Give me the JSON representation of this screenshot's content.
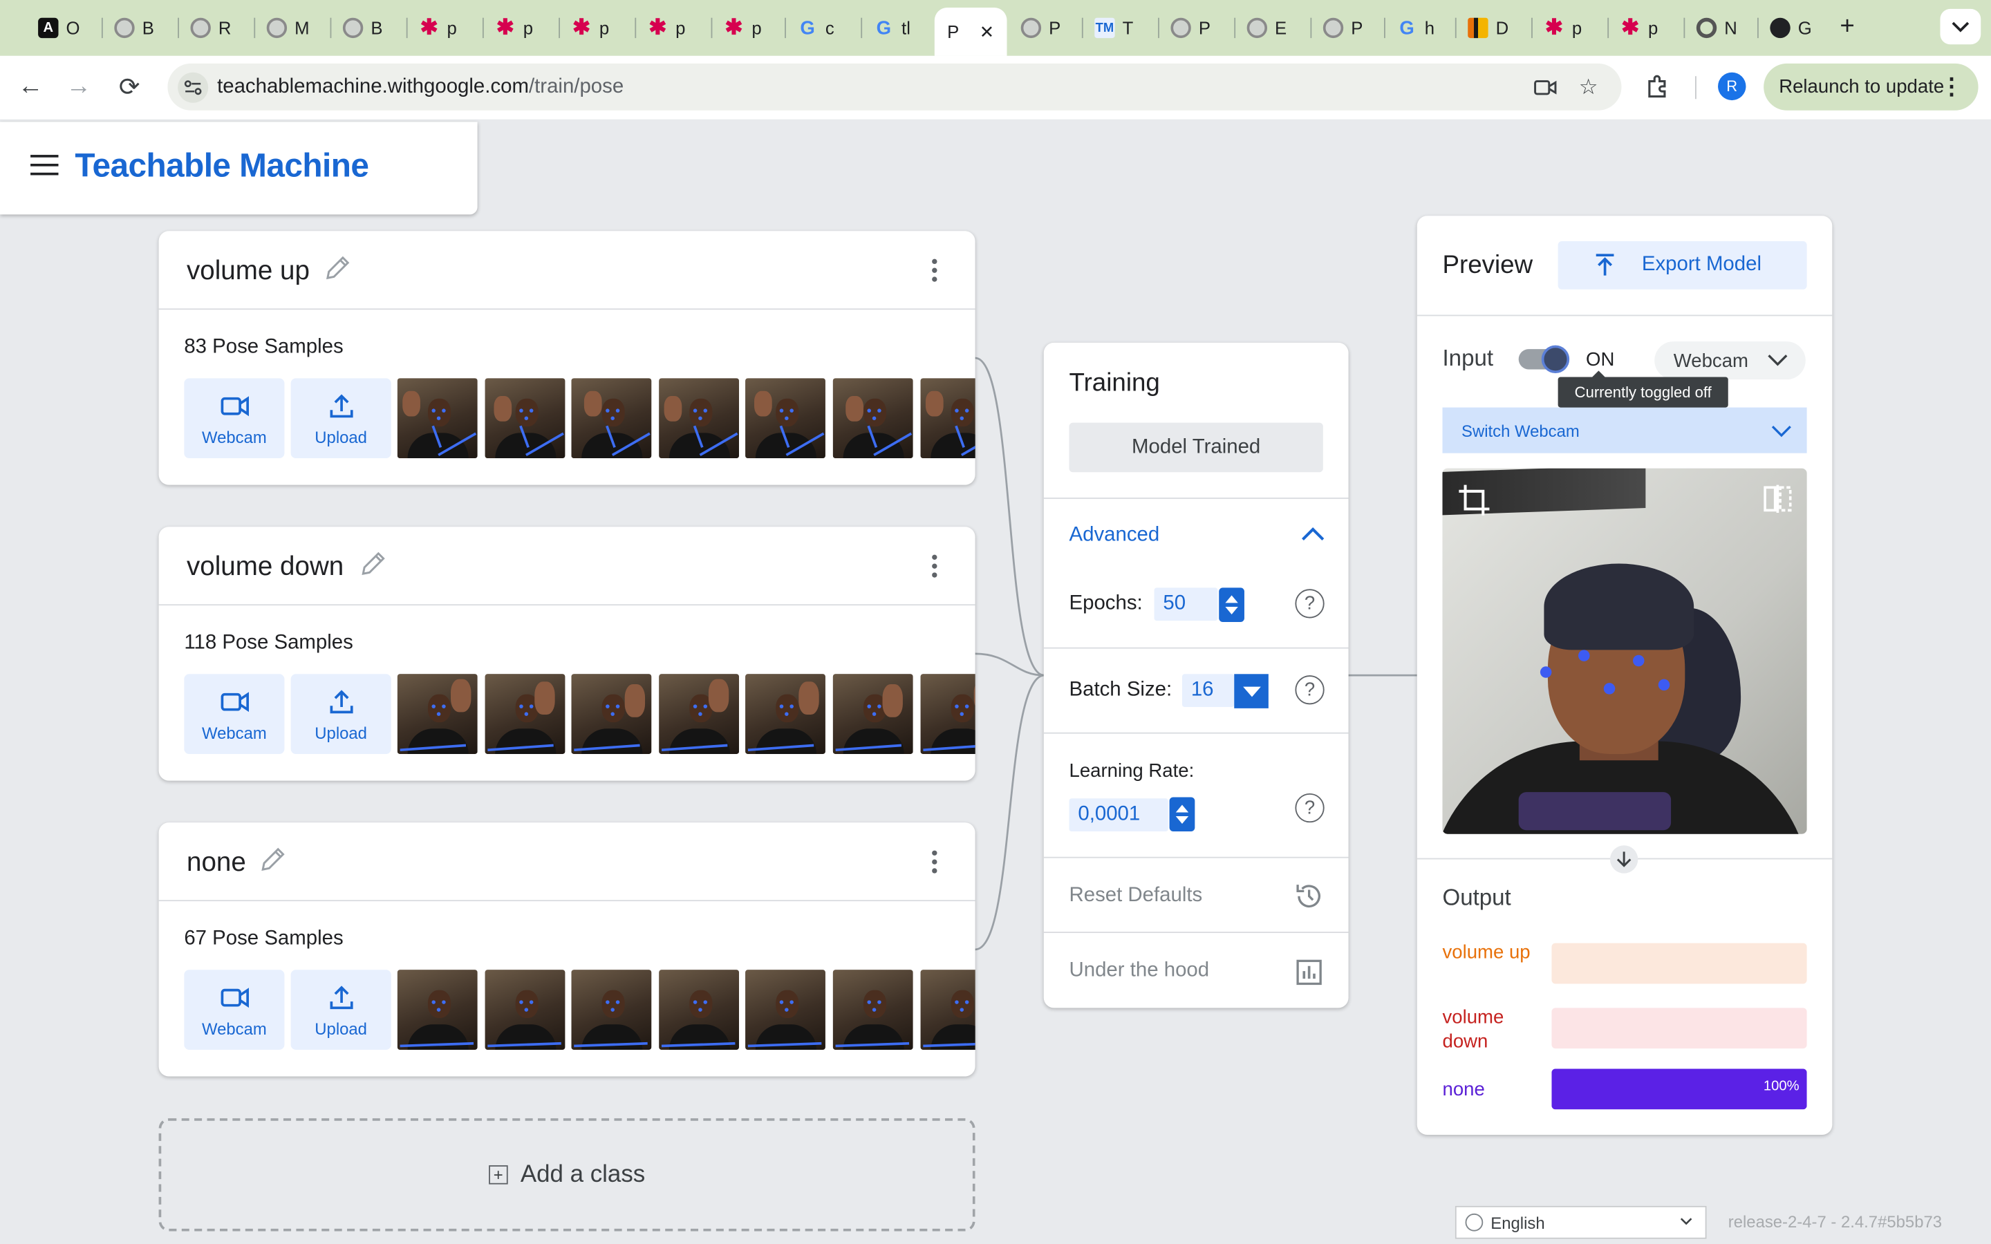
{
  "browser": {
    "tabs": [
      {
        "letter": "O",
        "icon": "dev-icon",
        "color": "#111111"
      },
      {
        "letter": "B",
        "icon": "globe-icon",
        "color": "#7a7a7a"
      },
      {
        "letter": "R",
        "icon": "globe-icon",
        "color": "#7a7a7a"
      },
      {
        "letter": "M",
        "icon": "globe-icon",
        "color": "#7a7a7a"
      },
      {
        "letter": "B",
        "icon": "globe-icon",
        "color": "#7a7a7a"
      },
      {
        "letter": "p",
        "icon": "asterisk-icon",
        "color": "#d6004f"
      },
      {
        "letter": "p",
        "icon": "asterisk-icon",
        "color": "#d6004f"
      },
      {
        "letter": "p",
        "icon": "asterisk-icon",
        "color": "#d6004f"
      },
      {
        "letter": "p",
        "icon": "asterisk-icon",
        "color": "#d6004f"
      },
      {
        "letter": "p",
        "icon": "asterisk-icon",
        "color": "#d6004f"
      },
      {
        "letter": "c",
        "icon": "google-icon",
        "color": "#4285f4"
      },
      {
        "letter": "tl",
        "icon": "google-icon",
        "color": "#4285f4"
      },
      {
        "letter": "P",
        "icon": "active",
        "color": "#202124"
      },
      {
        "letter": "P",
        "icon": "globe-icon",
        "color": "#7a7a7a"
      },
      {
        "letter": "T",
        "icon": "tm-icon",
        "color": "#1967d2"
      },
      {
        "letter": "P",
        "icon": "globe-icon",
        "color": "#7a7a7a"
      },
      {
        "letter": "E",
        "icon": "globe-icon",
        "color": "#7a7a7a"
      },
      {
        "letter": "P",
        "icon": "globe-icon",
        "color": "#7a7a7a"
      },
      {
        "letter": "h",
        "icon": "google-icon",
        "color": "#4285f4"
      },
      {
        "letter": "D",
        "icon": "chart-icon",
        "color": "#e8710a"
      },
      {
        "letter": "p",
        "icon": "asterisk-icon",
        "color": "#d6004f"
      },
      {
        "letter": "p",
        "icon": "asterisk-icon",
        "color": "#d6004f"
      },
      {
        "letter": "N",
        "icon": "chrome-icon",
        "color": "#202124"
      },
      {
        "letter": "G",
        "icon": "github-icon",
        "color": "#202124"
      }
    ],
    "url_host": "teachablemachine.withgoogle.com",
    "url_path": "/train/pose",
    "profile_initial": "R",
    "relaunch_label": "Relaunch to update"
  },
  "app": {
    "title": "Teachable Machine"
  },
  "classes": [
    {
      "name": "volume up",
      "samples_label": "83 Pose Samples",
      "webcam_label": "Webcam",
      "upload_label": "Upload",
      "pose": "wave"
    },
    {
      "name": "volume down",
      "samples_label": "118 Pose Samples",
      "webcam_label": "Webcam",
      "upload_label": "Upload",
      "pose": "hand"
    },
    {
      "name": "none",
      "samples_label": "67 Pose Samples",
      "webcam_label": "Webcam",
      "upload_label": "Upload",
      "pose": "still"
    }
  ],
  "add_class_label": "Add a class",
  "training": {
    "title": "Training",
    "button_label": "Model Trained",
    "advanced_label": "Advanced",
    "epochs_label": "Epochs:",
    "epochs_value": "50",
    "batch_label": "Batch Size:",
    "batch_value": "16",
    "lr_label": "Learning Rate:",
    "lr_value": "0,0001",
    "reset_label": "Reset Defaults",
    "hood_label": "Under the hood"
  },
  "preview": {
    "title": "Preview",
    "export_label": "Export Model",
    "input_label": "Input",
    "toggle_state": "ON",
    "webcam_select": "Webcam",
    "tooltip": "Currently toggled off",
    "switch_webcam": "Switch Webcam",
    "output_title": "Output",
    "outputs": [
      {
        "label": "volume up",
        "value": 0,
        "pct_label": "",
        "text_color": "#e8710a",
        "track_color": "#fce8dc",
        "fill_color": "#f5a26c"
      },
      {
        "label": "volume down",
        "value": 0,
        "pct_label": "",
        "text_color": "#c5221f",
        "track_color": "#fce4e6",
        "fill_color": "#e46a7a"
      },
      {
        "label": "none",
        "value": 1.0,
        "pct_label": "100%",
        "text_color": "#5b21d6",
        "track_color": "#e4dbfb",
        "fill_color": "#5b21e6"
      }
    ]
  },
  "footer": {
    "language": "English",
    "version": "release-2-4-7 - 2.4.7#5b5b73"
  }
}
